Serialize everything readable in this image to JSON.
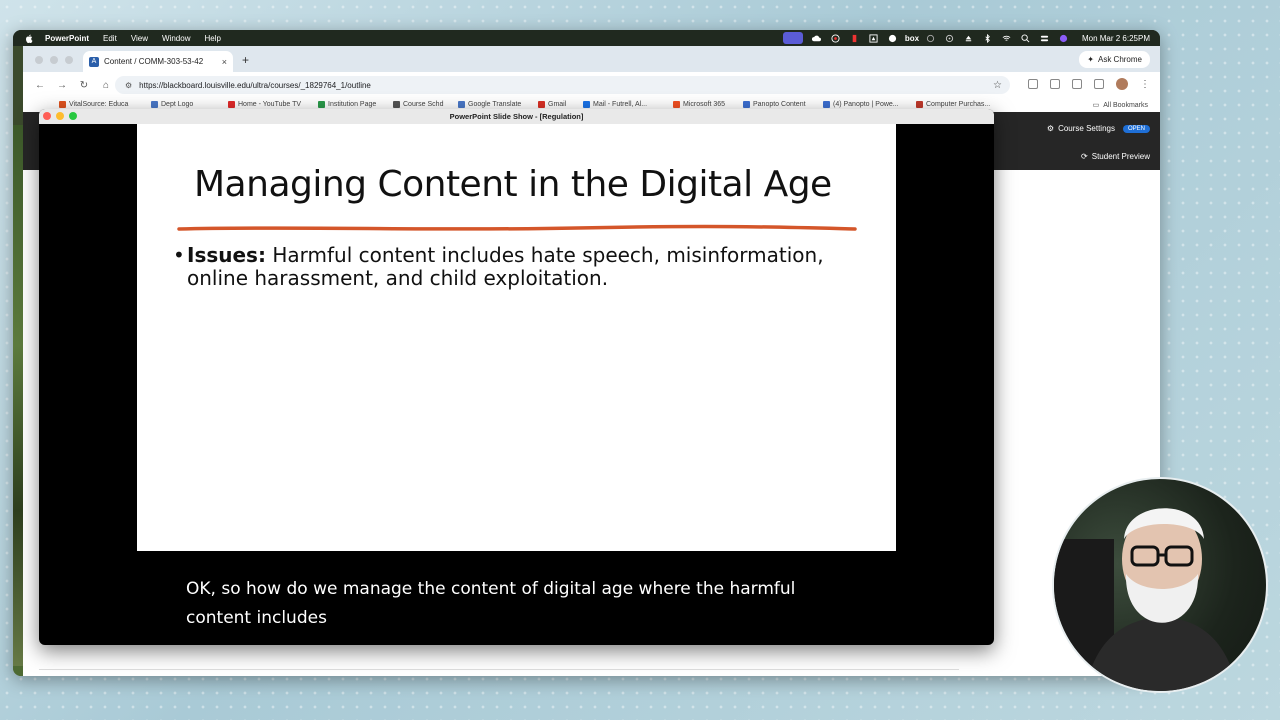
{
  "menubar": {
    "app": "PowerPoint",
    "items": [
      "Edit",
      "View",
      "Window",
      "Help"
    ],
    "tray_box": "box",
    "clock": "Mon Mar 2  6:25PM"
  },
  "browser": {
    "tab_title": "Content / COMM-303-53-42",
    "tab_close": "×",
    "new_tab": "+",
    "ask_chrome": "Ask Chrome",
    "url": "https://blackboard.louisville.edu/ultra/courses/_1829764_1/outline",
    "bookmarks": [
      {
        "label": "VitalSource: Educa",
        "color": "#e0531f"
      },
      {
        "label": "Dept Logo",
        "color": "#4a78c8"
      },
      {
        "label": "Home - YouTube TV",
        "color": "#e02a2a"
      },
      {
        "label": "Institution Page",
        "color": "#2a9a4a"
      },
      {
        "label": "Course Schd",
        "color": "#555555"
      },
      {
        "label": "Google Translate",
        "color": "#4a78c8"
      },
      {
        "label": "Gmail",
        "color": "#d93025"
      },
      {
        "label": "Mail - Futrell, Al...",
        "color": "#1a73e8"
      },
      {
        "label": "Microsoft 365",
        "color": "#f25022"
      },
      {
        "label": "Panopto Content",
        "color": "#3c6fd1"
      },
      {
        "label": "(4) Panopto | Powe...",
        "color": "#3c6fd1"
      },
      {
        "label": "Computer Purchas...",
        "color": "#c0392b"
      }
    ],
    "all_bookmarks": "All Bookmarks"
  },
  "blackboard": {
    "course_settings": "Course Settings",
    "open_badge": "OPEN",
    "student_preview": "Student Preview"
  },
  "slideshow": {
    "window_title": "PowerPoint Slide Show - [Regulation]",
    "slide_title": "Managing Content in the Digital Age",
    "bullet_marker": "•",
    "bullet_label": "Issues:",
    "bullet_text": " Harmful content includes hate speech, misinformation, online harassment, and child exploitation.",
    "underline_color": "#d4562a",
    "caption_line1": "OK, so how do we manage the content of digital age where the harmful",
    "caption_line2": "content includes"
  }
}
